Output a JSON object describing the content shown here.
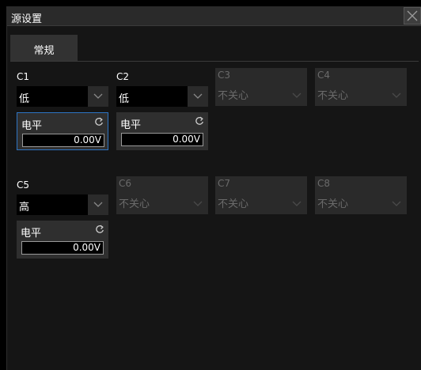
{
  "window": {
    "title": "源设置"
  },
  "tabs": [
    {
      "label": "常规"
    }
  ],
  "channels": {
    "c1": {
      "label": "C1",
      "value": "低",
      "level_label": "电平",
      "level_value": "0.00V"
    },
    "c2": {
      "label": "C2",
      "value": "低",
      "level_label": "电平",
      "level_value": "0.00V"
    },
    "c3": {
      "label": "C3",
      "value": "不关心"
    },
    "c4": {
      "label": "C4",
      "value": "不关心"
    },
    "c5": {
      "label": "C5",
      "value": "高",
      "level_label": "电平",
      "level_value": "0.00V"
    },
    "c6": {
      "label": "C6",
      "value": "不关心"
    },
    "c7": {
      "label": "C7",
      "value": "不关心"
    },
    "c8": {
      "label": "C8",
      "value": "不关心"
    }
  },
  "icons": {
    "close": "close-icon",
    "dropdown": "chevron-down-icon",
    "refresh": "refresh-icon"
  },
  "colors": {
    "selected_border": "#2d74c2",
    "disabled_text": "#6a6a6a"
  }
}
